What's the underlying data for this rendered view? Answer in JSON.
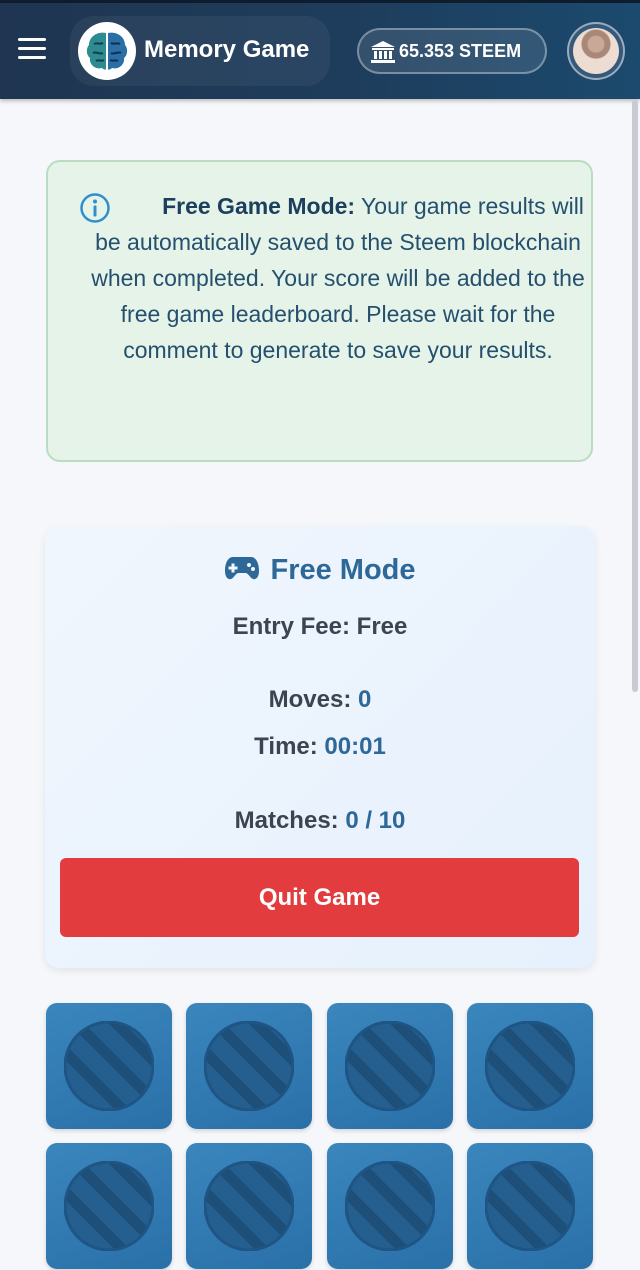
{
  "header": {
    "title": "Memory Game",
    "balance": "65.353 STEEM",
    "colors": {
      "bar": "#1f3551",
      "text": "#ffffff"
    }
  },
  "notice": {
    "heading": "Free Game Mode:",
    "message": " Your game results will be automatically saved to the Steem blockchain when completed. Your score will be added to the free game leaderboard. Please wait for the comment to generate to save your results."
  },
  "game": {
    "mode_title": "Free Mode",
    "entry_fee_label": "Entry Fee:",
    "entry_fee_value": "Free",
    "moves_label": "Moves:",
    "moves_value": "0",
    "time_label": "Time:",
    "time_value": "00:01",
    "matches_label": "Matches:",
    "matches_value": "0 / 10",
    "quit_label": "Quit Game"
  },
  "board": {
    "tile_icon": "striped-circle-icon",
    "face_down_tiles_visible": 8
  },
  "colors": {
    "accent": "#2d6898",
    "danger": "#e23c3e",
    "notice_bg": "#e6f3e9",
    "tile": "#2a70a8"
  }
}
